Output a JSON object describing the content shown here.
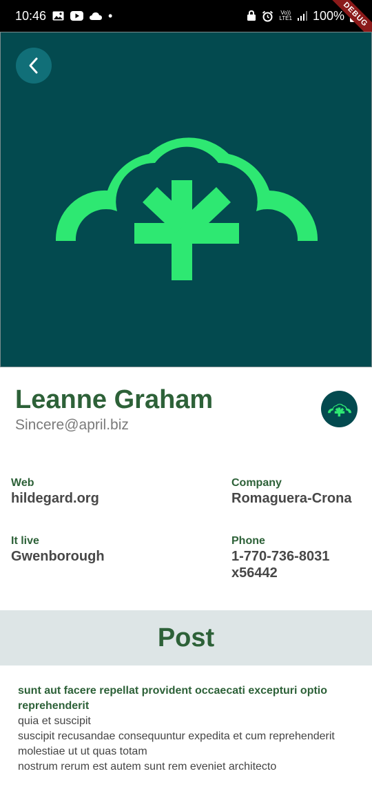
{
  "status_bar": {
    "time": "10:46",
    "dot": "•",
    "battery": "100%",
    "lte_top": "Vo))",
    "lte_bottom": "LTE1"
  },
  "debug_banner": "DEBUG",
  "profile": {
    "name": "Leanne Graham",
    "email": "Sincere@april.biz"
  },
  "info": {
    "web_label": "Web",
    "web_value": "hildegard.org",
    "company_label": "Company",
    "company_value": "Romaguera-Crona",
    "city_label": "It live",
    "city_value": "Gwenborough",
    "phone_label": "Phone",
    "phone_value": "1-770-736-8031 x56442"
  },
  "posts": {
    "header": "Post",
    "items": [
      {
        "title": "sunt aut facere repellat provident occaecati excepturi optio reprehenderit",
        "body": "quia et suscipit\nsuscipit recusandae consequuntur expedita et cum reprehenderit molestiae ut ut quas totam\nnostrum rerum est autem sunt rem eveniet architecto"
      }
    ]
  },
  "colors": {
    "primary_dark": "#034a4f",
    "accent_green": "#2ee872",
    "text_green": "#2d6138",
    "post_header_bg": "#dde5e6"
  },
  "icons": {
    "back": "chevron-left-icon",
    "logo": "tree-cloud-logo-icon"
  }
}
